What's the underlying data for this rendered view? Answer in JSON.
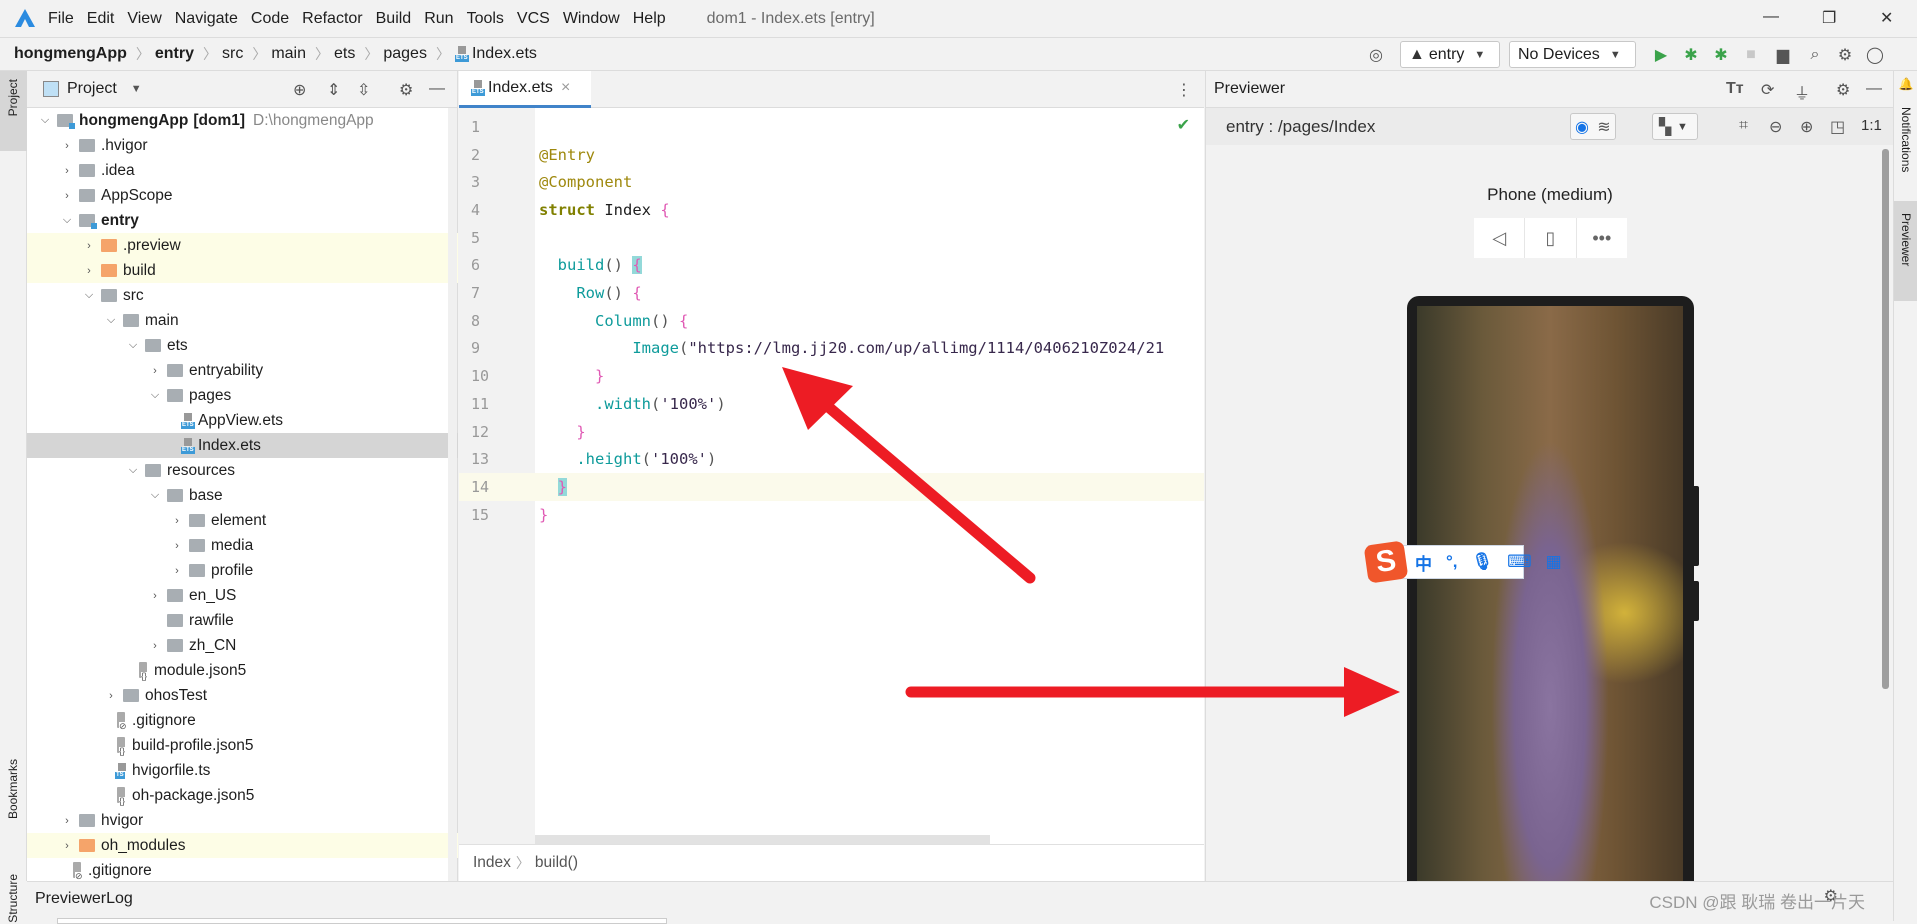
{
  "menubar": {
    "items": [
      "File",
      "Edit",
      "View",
      "Navigate",
      "Code",
      "Refactor",
      "Build",
      "Run",
      "Tools",
      "VCS",
      "Window",
      "Help"
    ],
    "window_title": "dom1 - Index.ets [entry]"
  },
  "navbar": {
    "crumbs": [
      "hongmengApp",
      "entry",
      "src",
      "main",
      "ets",
      "pages",
      "Index.ets"
    ],
    "run_config": "entry",
    "device": "No Devices"
  },
  "left_strip": {
    "project": "Project",
    "bookmarks": "Bookmarks",
    "structure": "Structure"
  },
  "project": {
    "title": "Project",
    "tree": [
      {
        "label": "hongmengApp",
        "bold_suffix": "[dom1]",
        "path": "D:\\hongmengApp",
        "level": 0,
        "type": "module",
        "expanded": true,
        "bold": true
      },
      {
        "label": ".hvigor",
        "level": 1,
        "type": "folder"
      },
      {
        "label": ".idea",
        "level": 1,
        "type": "folder"
      },
      {
        "label": "AppScope",
        "level": 1,
        "type": "folder"
      },
      {
        "label": "entry",
        "level": 1,
        "type": "module",
        "expanded": true,
        "bold": true
      },
      {
        "label": ".preview",
        "level": 2,
        "type": "folder-orange",
        "highlight": true
      },
      {
        "label": "build",
        "level": 2,
        "type": "folder-orange",
        "highlight": true
      },
      {
        "label": "src",
        "level": 2,
        "type": "folder",
        "expanded": true
      },
      {
        "label": "main",
        "level": 3,
        "type": "folder",
        "expanded": true
      },
      {
        "label": "ets",
        "level": 4,
        "type": "folder",
        "expanded": true
      },
      {
        "label": "entryability",
        "level": 5,
        "type": "folder"
      },
      {
        "label": "pages",
        "level": 5,
        "type": "folder",
        "expanded": true
      },
      {
        "label": "AppView.ets",
        "level": 6,
        "type": "ets"
      },
      {
        "label": "Index.ets",
        "level": 6,
        "type": "ets",
        "selected": true
      },
      {
        "label": "resources",
        "level": 4,
        "type": "folder",
        "expanded": true
      },
      {
        "label": "base",
        "level": 5,
        "type": "folder",
        "expanded": true
      },
      {
        "label": "element",
        "level": 6,
        "type": "folder"
      },
      {
        "label": "media",
        "level": 6,
        "type": "folder"
      },
      {
        "label": "profile",
        "level": 6,
        "type": "folder"
      },
      {
        "label": "en_US",
        "level": 5,
        "type": "folder"
      },
      {
        "label": "rawfile",
        "level": 5,
        "type": "folder",
        "leaf": true
      },
      {
        "label": "zh_CN",
        "level": 5,
        "type": "folder"
      },
      {
        "label": "module.json5",
        "level": 4,
        "type": "json"
      },
      {
        "label": "ohosTest",
        "level": 3,
        "type": "folder"
      },
      {
        "label": ".gitignore",
        "level": 3,
        "type": "git"
      },
      {
        "label": "build-profile.json5",
        "level": 3,
        "type": "json"
      },
      {
        "label": "hvigorfile.ts",
        "level": 3,
        "type": "ts"
      },
      {
        "label": "oh-package.json5",
        "level": 3,
        "type": "json"
      },
      {
        "label": "hvigor",
        "level": 1,
        "type": "folder"
      },
      {
        "label": "oh_modules",
        "level": 1,
        "type": "folder-orange",
        "highlight": true
      },
      {
        "label": ".gitignore",
        "level": 1,
        "type": "git"
      }
    ]
  },
  "editor": {
    "tab": "Index.ets",
    "current_line": 14,
    "lines": [
      [],
      [
        {
          "t": "@Entry",
          "c": "dec"
        }
      ],
      [
        {
          "t": "@Component",
          "c": "dec"
        }
      ],
      [
        {
          "t": "struct",
          "c": "kw"
        },
        {
          "t": " Index ",
          "c": "name"
        },
        {
          "t": "{",
          "c": "brace"
        }
      ],
      [],
      [
        {
          "t": "  build",
          "c": "fn"
        },
        {
          "t": "() ",
          "c": "p"
        },
        {
          "t": "{",
          "c": "brace match"
        }
      ],
      [
        {
          "t": "    Row",
          "c": "fn"
        },
        {
          "t": "() ",
          "c": "p"
        },
        {
          "t": "{",
          "c": "brace"
        }
      ],
      [
        {
          "t": "      Column",
          "c": "fn"
        },
        {
          "t": "() ",
          "c": "p"
        },
        {
          "t": "{",
          "c": "brace"
        }
      ],
      [
        {
          "t": "          Image",
          "c": "fn"
        },
        {
          "t": "(",
          "c": "p"
        },
        {
          "t": "\"https://lmg.jj20.com/up/allimg/1114/0406210Z024/21",
          "c": "str"
        }
      ],
      [
        {
          "t": "      }",
          "c": "brace"
        }
      ],
      [
        {
          "t": "      .width",
          "c": "fn"
        },
        {
          "t": "(",
          "c": "p"
        },
        {
          "t": "'100%'",
          "c": "str"
        },
        {
          "t": ")",
          "c": "p"
        }
      ],
      [
        {
          "t": "    }",
          "c": "brace"
        }
      ],
      [
        {
          "t": "    .height",
          "c": "fn"
        },
        {
          "t": "(",
          "c": "p"
        },
        {
          "t": "'100%'",
          "c": "str"
        },
        {
          "t": ")",
          "c": "p"
        }
      ],
      [
        {
          "t": "  ",
          "c": "p"
        },
        {
          "t": "}",
          "c": "brace match"
        }
      ],
      [
        {
          "t": "}",
          "c": "brace"
        }
      ]
    ],
    "breadcrumb": [
      "Index",
      "build()"
    ]
  },
  "previewer": {
    "title": "Previewer",
    "route": "entry : /pages/Index",
    "zoom_label": "1:1",
    "device_name": "Phone (medium)"
  },
  "right_strip": {
    "notifications": "Notifications",
    "previewer": "Previewer"
  },
  "ime": {
    "chinese": "中",
    "punct": "°,"
  },
  "bottom": {
    "title": "PreviewerLog"
  },
  "watermark": "CSDN @跟 耿瑞 卷出一片天",
  "colors": {
    "accent": "#4083c9",
    "annotation_arrow": "#ed1c24",
    "run_green": "#3aa34a"
  }
}
